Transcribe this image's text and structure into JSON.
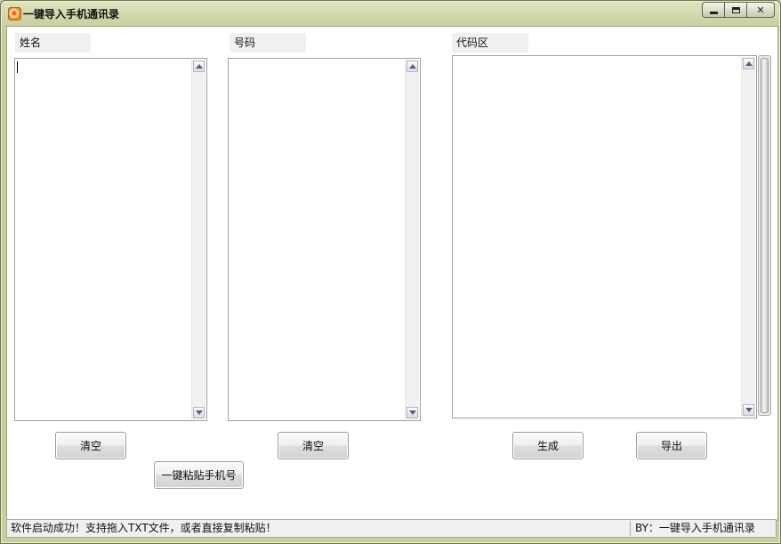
{
  "window": {
    "title": "一键导入手机通讯录",
    "icon": "app-icon"
  },
  "labels": {
    "name": "姓名",
    "number": "号码",
    "code_area": "代码区"
  },
  "inputs": {
    "name_value": "",
    "number_value": "",
    "code_value": ""
  },
  "buttons": {
    "clear_name": "清空",
    "clear_number": "清空",
    "paste_numbers": "一键粘贴手机号",
    "generate": "生成",
    "export": "导出"
  },
  "status": {
    "message": "软件启动成功！支持拖入TXT文件，或者直接复制粘贴！",
    "credit": "BY：一键导入手机通讯录"
  },
  "colors": {
    "frame": "#c8cf9f",
    "client": "#ffffff",
    "label_bg": "#f0f0f0",
    "scroll_arrow": "#4d6185"
  }
}
